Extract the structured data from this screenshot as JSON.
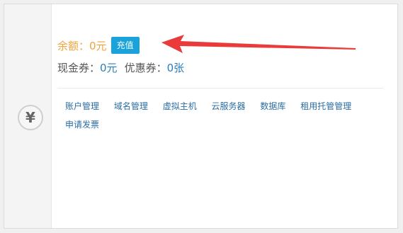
{
  "account": {
    "balance_label": "余额：",
    "balance_value": "0元",
    "recharge_button": "充值",
    "cash_coupon_label": "现金券：",
    "cash_coupon_value": "0元",
    "discount_coupon_label": "优惠券：",
    "discount_coupon_value": "0张"
  },
  "icon": {
    "yen_symbol": "¥"
  },
  "links": [
    "账户管理",
    "域名管理",
    "虚拟主机",
    "云服务器",
    "数据库",
    "租用托管管理",
    "申请发票"
  ],
  "colors": {
    "balance": "#f0a23c",
    "button": "#1aa3db",
    "link": "#2b6ea3",
    "arrow": "#ea3a3a"
  }
}
